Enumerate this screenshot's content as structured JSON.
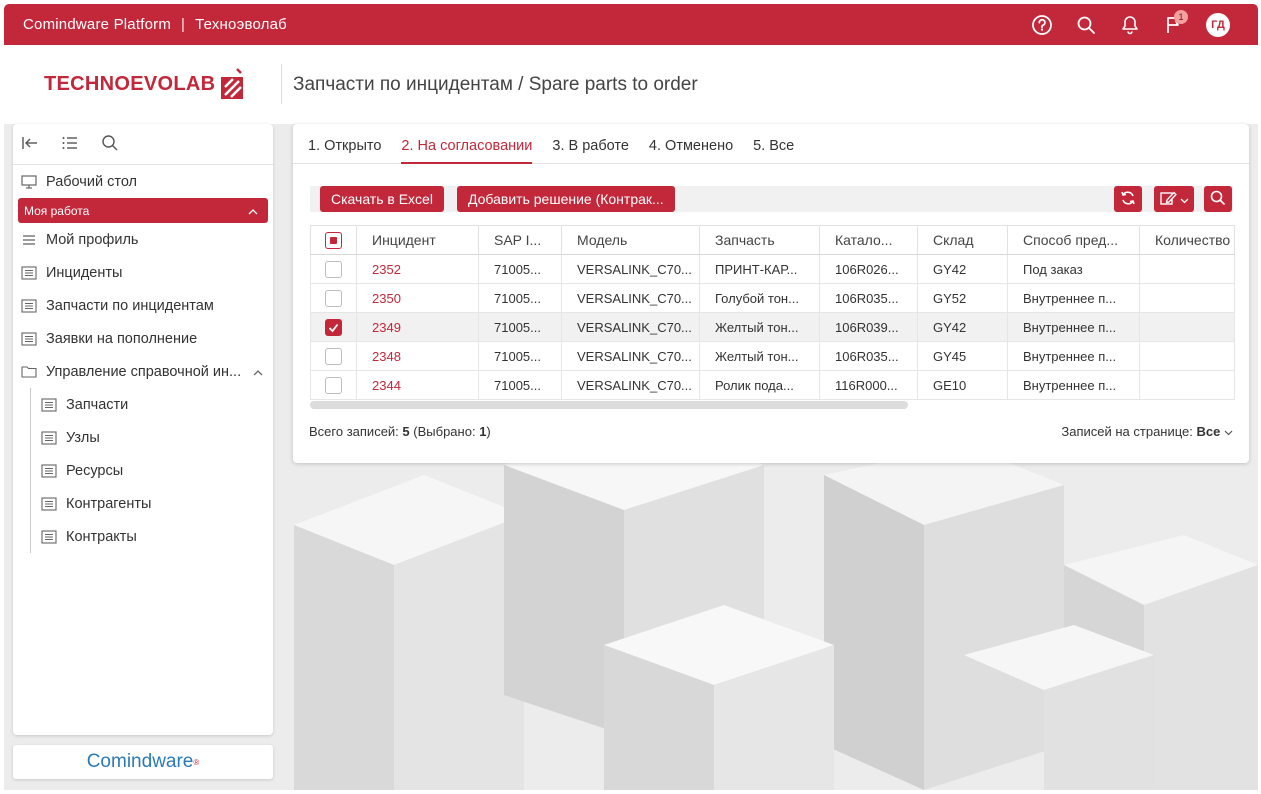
{
  "topbar": {
    "platform": "Comindware Platform",
    "separator": "|",
    "org": "Техноэволаб",
    "notifications_badge": "1",
    "avatar": "ГД",
    "icons": [
      "help-icon",
      "search-icon",
      "bell-icon",
      "flag-icon"
    ]
  },
  "header": {
    "logo": "TECHNOEVOLAB",
    "title": "Запчасти по инцидентам / Spare parts to order"
  },
  "sidebar": {
    "items": [
      {
        "label": "Рабочий стол"
      }
    ],
    "section": "Моя работа",
    "work_items": [
      {
        "label": "Мой профиль"
      },
      {
        "label": "Инциденты"
      },
      {
        "label": "Запчасти по инцидентам"
      },
      {
        "label": "Заявки на пополнение"
      }
    ],
    "folder": "Управление справочной ин...",
    "sub_items": [
      {
        "label": "Запчасти"
      },
      {
        "label": "Узлы"
      },
      {
        "label": "Ресурсы"
      },
      {
        "label": "Контрагенты"
      },
      {
        "label": "Контракты"
      }
    ],
    "footer_brand_a": "Comind",
    "footer_brand_b": "ware",
    "footer_brand_reg": "®"
  },
  "tabs": [
    {
      "label": "1. Открыто",
      "active": false
    },
    {
      "label": "2. На согласовании",
      "active": true
    },
    {
      "label": "3. В работе",
      "active": false
    },
    {
      "label": "4. Отменено",
      "active": false
    },
    {
      "label": "5. Все",
      "active": false
    }
  ],
  "toolbar": {
    "excel_label": "Скачать в Excel",
    "add_label": "Добавить решение (Контрак..."
  },
  "table": {
    "columns": [
      "Инцидент",
      "SAP I...",
      "Модель",
      "Запчасть",
      "Катало...",
      "Склад",
      "Способ пред...",
      "Количество"
    ],
    "rows": [
      {
        "checked": false,
        "cells": [
          "2352",
          "71005...",
          "VERSALINK_C70...",
          "ПРИНТ-КАР...",
          "106R026...",
          "GY42",
          "Под заказ",
          ""
        ]
      },
      {
        "checked": false,
        "cells": [
          "2350",
          "71005...",
          "VERSALINK_C70...",
          "Голубой тон...",
          "106R035...",
          "GY52",
          "Внутреннее п...",
          ""
        ]
      },
      {
        "checked": true,
        "cells": [
          "2349",
          "71005...",
          "VERSALINK_C70...",
          "Желтый тон...",
          "106R039...",
          "GY42",
          "Внутреннее п...",
          ""
        ]
      },
      {
        "checked": false,
        "cells": [
          "2348",
          "71005...",
          "VERSALINK_C70...",
          "Желтый тон...",
          "106R035...",
          "GY45",
          "Внутреннее п...",
          ""
        ]
      },
      {
        "checked": false,
        "cells": [
          "2344",
          "71005...",
          "VERSALINK_C70...",
          "Ролик пода...",
          "116R000...",
          "GE10",
          "Внутреннее п...",
          ""
        ]
      }
    ]
  },
  "summary": {
    "total_label": "Всего записей:",
    "total": "5",
    "selected_label": "(Выбрано:",
    "selected": "1",
    "selected_close": ")",
    "per_page_label": "Записей на странице:",
    "per_page_value": "Все"
  },
  "colors": {
    "accent": "#c3273a"
  }
}
